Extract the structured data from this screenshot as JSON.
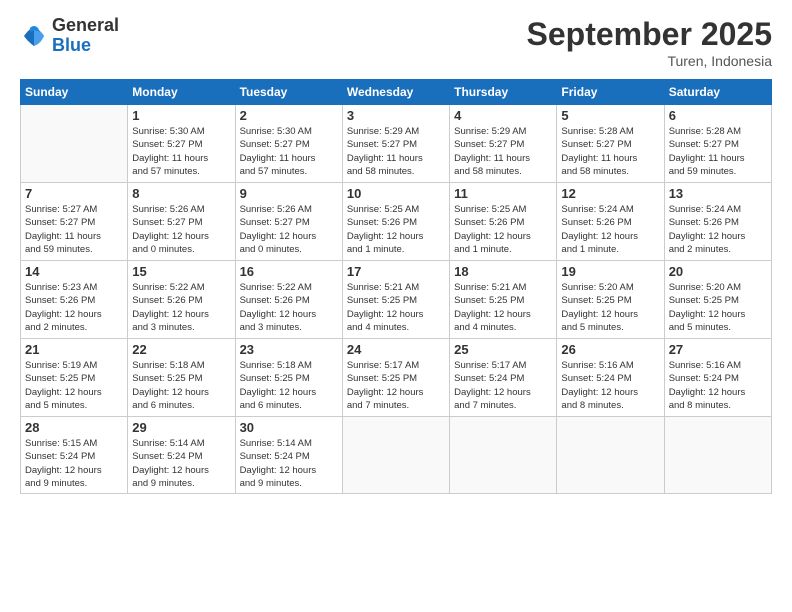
{
  "logo": {
    "general": "General",
    "blue": "Blue"
  },
  "title": "September 2025",
  "location": "Turen, Indonesia",
  "days_header": [
    "Sunday",
    "Monday",
    "Tuesday",
    "Wednesday",
    "Thursday",
    "Friday",
    "Saturday"
  ],
  "weeks": [
    [
      {
        "day": "",
        "info": ""
      },
      {
        "day": "1",
        "info": "Sunrise: 5:30 AM\nSunset: 5:27 PM\nDaylight: 11 hours\nand 57 minutes."
      },
      {
        "day": "2",
        "info": "Sunrise: 5:30 AM\nSunset: 5:27 PM\nDaylight: 11 hours\nand 57 minutes."
      },
      {
        "day": "3",
        "info": "Sunrise: 5:29 AM\nSunset: 5:27 PM\nDaylight: 11 hours\nand 58 minutes."
      },
      {
        "day": "4",
        "info": "Sunrise: 5:29 AM\nSunset: 5:27 PM\nDaylight: 11 hours\nand 58 minutes."
      },
      {
        "day": "5",
        "info": "Sunrise: 5:28 AM\nSunset: 5:27 PM\nDaylight: 11 hours\nand 58 minutes."
      },
      {
        "day": "6",
        "info": "Sunrise: 5:28 AM\nSunset: 5:27 PM\nDaylight: 11 hours\nand 59 minutes."
      }
    ],
    [
      {
        "day": "7",
        "info": "Sunrise: 5:27 AM\nSunset: 5:27 PM\nDaylight: 11 hours\nand 59 minutes."
      },
      {
        "day": "8",
        "info": "Sunrise: 5:26 AM\nSunset: 5:27 PM\nDaylight: 12 hours\nand 0 minutes."
      },
      {
        "day": "9",
        "info": "Sunrise: 5:26 AM\nSunset: 5:27 PM\nDaylight: 12 hours\nand 0 minutes."
      },
      {
        "day": "10",
        "info": "Sunrise: 5:25 AM\nSunset: 5:26 PM\nDaylight: 12 hours\nand 1 minute."
      },
      {
        "day": "11",
        "info": "Sunrise: 5:25 AM\nSunset: 5:26 PM\nDaylight: 12 hours\nand 1 minute."
      },
      {
        "day": "12",
        "info": "Sunrise: 5:24 AM\nSunset: 5:26 PM\nDaylight: 12 hours\nand 1 minute."
      },
      {
        "day": "13",
        "info": "Sunrise: 5:24 AM\nSunset: 5:26 PM\nDaylight: 12 hours\nand 2 minutes."
      }
    ],
    [
      {
        "day": "14",
        "info": "Sunrise: 5:23 AM\nSunset: 5:26 PM\nDaylight: 12 hours\nand 2 minutes."
      },
      {
        "day": "15",
        "info": "Sunrise: 5:22 AM\nSunset: 5:26 PM\nDaylight: 12 hours\nand 3 minutes."
      },
      {
        "day": "16",
        "info": "Sunrise: 5:22 AM\nSunset: 5:26 PM\nDaylight: 12 hours\nand 3 minutes."
      },
      {
        "day": "17",
        "info": "Sunrise: 5:21 AM\nSunset: 5:25 PM\nDaylight: 12 hours\nand 4 minutes."
      },
      {
        "day": "18",
        "info": "Sunrise: 5:21 AM\nSunset: 5:25 PM\nDaylight: 12 hours\nand 4 minutes."
      },
      {
        "day": "19",
        "info": "Sunrise: 5:20 AM\nSunset: 5:25 PM\nDaylight: 12 hours\nand 5 minutes."
      },
      {
        "day": "20",
        "info": "Sunrise: 5:20 AM\nSunset: 5:25 PM\nDaylight: 12 hours\nand 5 minutes."
      }
    ],
    [
      {
        "day": "21",
        "info": "Sunrise: 5:19 AM\nSunset: 5:25 PM\nDaylight: 12 hours\nand 5 minutes."
      },
      {
        "day": "22",
        "info": "Sunrise: 5:18 AM\nSunset: 5:25 PM\nDaylight: 12 hours\nand 6 minutes."
      },
      {
        "day": "23",
        "info": "Sunrise: 5:18 AM\nSunset: 5:25 PM\nDaylight: 12 hours\nand 6 minutes."
      },
      {
        "day": "24",
        "info": "Sunrise: 5:17 AM\nSunset: 5:25 PM\nDaylight: 12 hours\nand 7 minutes."
      },
      {
        "day": "25",
        "info": "Sunrise: 5:17 AM\nSunset: 5:24 PM\nDaylight: 12 hours\nand 7 minutes."
      },
      {
        "day": "26",
        "info": "Sunrise: 5:16 AM\nSunset: 5:24 PM\nDaylight: 12 hours\nand 8 minutes."
      },
      {
        "day": "27",
        "info": "Sunrise: 5:16 AM\nSunset: 5:24 PM\nDaylight: 12 hours\nand 8 minutes."
      }
    ],
    [
      {
        "day": "28",
        "info": "Sunrise: 5:15 AM\nSunset: 5:24 PM\nDaylight: 12 hours\nand 9 minutes."
      },
      {
        "day": "29",
        "info": "Sunrise: 5:14 AM\nSunset: 5:24 PM\nDaylight: 12 hours\nand 9 minutes."
      },
      {
        "day": "30",
        "info": "Sunrise: 5:14 AM\nSunset: 5:24 PM\nDaylight: 12 hours\nand 9 minutes."
      },
      {
        "day": "",
        "info": ""
      },
      {
        "day": "",
        "info": ""
      },
      {
        "day": "",
        "info": ""
      },
      {
        "day": "",
        "info": ""
      }
    ]
  ]
}
